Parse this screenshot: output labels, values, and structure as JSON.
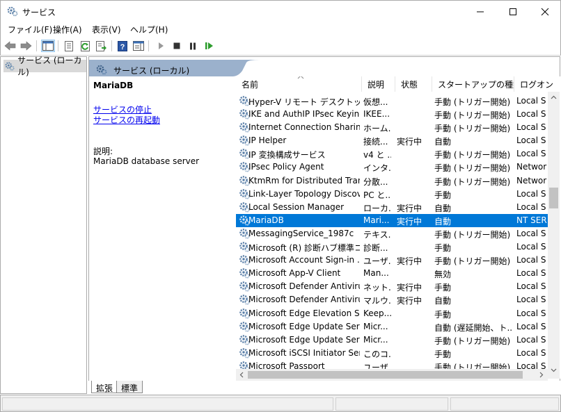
{
  "window": {
    "title": "サービス"
  },
  "menu": [
    "ファイル(F)",
    "操作(A)",
    "表示(V)",
    "ヘルプ(H)"
  ],
  "toolbar": {
    "icons": [
      "back-icon",
      "forward-icon",
      "show-hide-tree-icon",
      "properties-icon",
      "refresh-icon",
      "export-list-icon",
      "help-icon",
      "show-action-pane-icon",
      "start-service-icon",
      "stop-service-icon",
      "pause-service-icon",
      "resume-service-icon"
    ]
  },
  "tree": {
    "root_label": "サービス (ローカル)"
  },
  "main": {
    "header_label": "サービス (ローカル)",
    "selected_service": "MariaDB",
    "stop_link": "サービスの停止",
    "restart_link": "サービスの再起動",
    "desc_label": "説明:",
    "desc_text": "MariaDB database server"
  },
  "columns": [
    "名前",
    "説明",
    "状態",
    "スタートアップの種類",
    "ログオン"
  ],
  "rows": [
    [
      "Hyper-V リモート デスクトップ仮...",
      "仮想...",
      "",
      "手動 (トリガー開始)",
      "Local S"
    ],
    [
      "IKE and AuthIP IPsec Keying...",
      "IKEE...",
      "",
      "手動 (トリガー開始)",
      "Local S"
    ],
    [
      "Internet Connection Sharin...",
      "ホーム...",
      "",
      "手動 (トリガー開始)",
      "Local S"
    ],
    [
      "IP Helper",
      "接続...",
      "実行中",
      "自動",
      "Local S"
    ],
    [
      "IP 変換構成サービス",
      "v4 と ...",
      "",
      "手動 (トリガー開始)",
      "Local S"
    ],
    [
      "IPsec Policy Agent",
      "インタ...",
      "",
      "手動 (トリガー開始)",
      "Networ"
    ],
    [
      "KtmRm for Distributed Trans...",
      "分散...",
      "",
      "手動 (トリガー開始)",
      "Networ"
    ],
    [
      "Link-Layer Topology Discov...",
      "PC と...",
      "",
      "手動",
      "Local S"
    ],
    [
      "Local Session Manager",
      "ローカ...",
      "実行中",
      "自動",
      "Local S"
    ],
    [
      "MariaDB",
      "Mari...",
      "実行中",
      "自動",
      "NT SER"
    ],
    [
      "MessagingService_1987c",
      "テキス...",
      "",
      "手動 (トリガー開始)",
      "Local S"
    ],
    [
      "Microsoft (R) 診断ハブ標準コ...",
      "診断...",
      "",
      "手動",
      "Local S"
    ],
    [
      "Microsoft Account Sign-in ...",
      "ユーザ...",
      "実行中",
      "手動 (トリガー開始)",
      "Local S"
    ],
    [
      "Microsoft App-V Client",
      "Man...",
      "",
      "無効",
      "Local S"
    ],
    [
      "Microsoft Defender Antiviru...",
      "ネット...",
      "実行中",
      "手動",
      "Local S"
    ],
    [
      "Microsoft Defender Antiviru...",
      "マルウ...",
      "実行中",
      "自動",
      "Local S"
    ],
    [
      "Microsoft Edge Elevation Se...",
      "Keep...",
      "",
      "手動",
      "Local S"
    ],
    [
      "Microsoft Edge Update Serv...",
      "Micr...",
      "",
      "自動 (遅延開始、ト...",
      "Local S"
    ],
    [
      "Microsoft Edge Update Serv...",
      "Micr...",
      "",
      "手動 (トリガー開始)",
      "Local S"
    ],
    [
      "Microsoft iSCSI Initiator Ser...",
      "このコ...",
      "",
      "手動",
      "Local S"
    ],
    [
      "Microsoft Passport",
      "ユーザ...",
      "",
      "手動 (トリガー開始)",
      "Local S"
    ]
  ],
  "selected_row": 9,
  "tabs": [
    "拡張",
    "標準"
  ],
  "colors": {
    "selection": "#0078d7",
    "header_band": "#9bb1cc",
    "link": "#0000ee"
  }
}
